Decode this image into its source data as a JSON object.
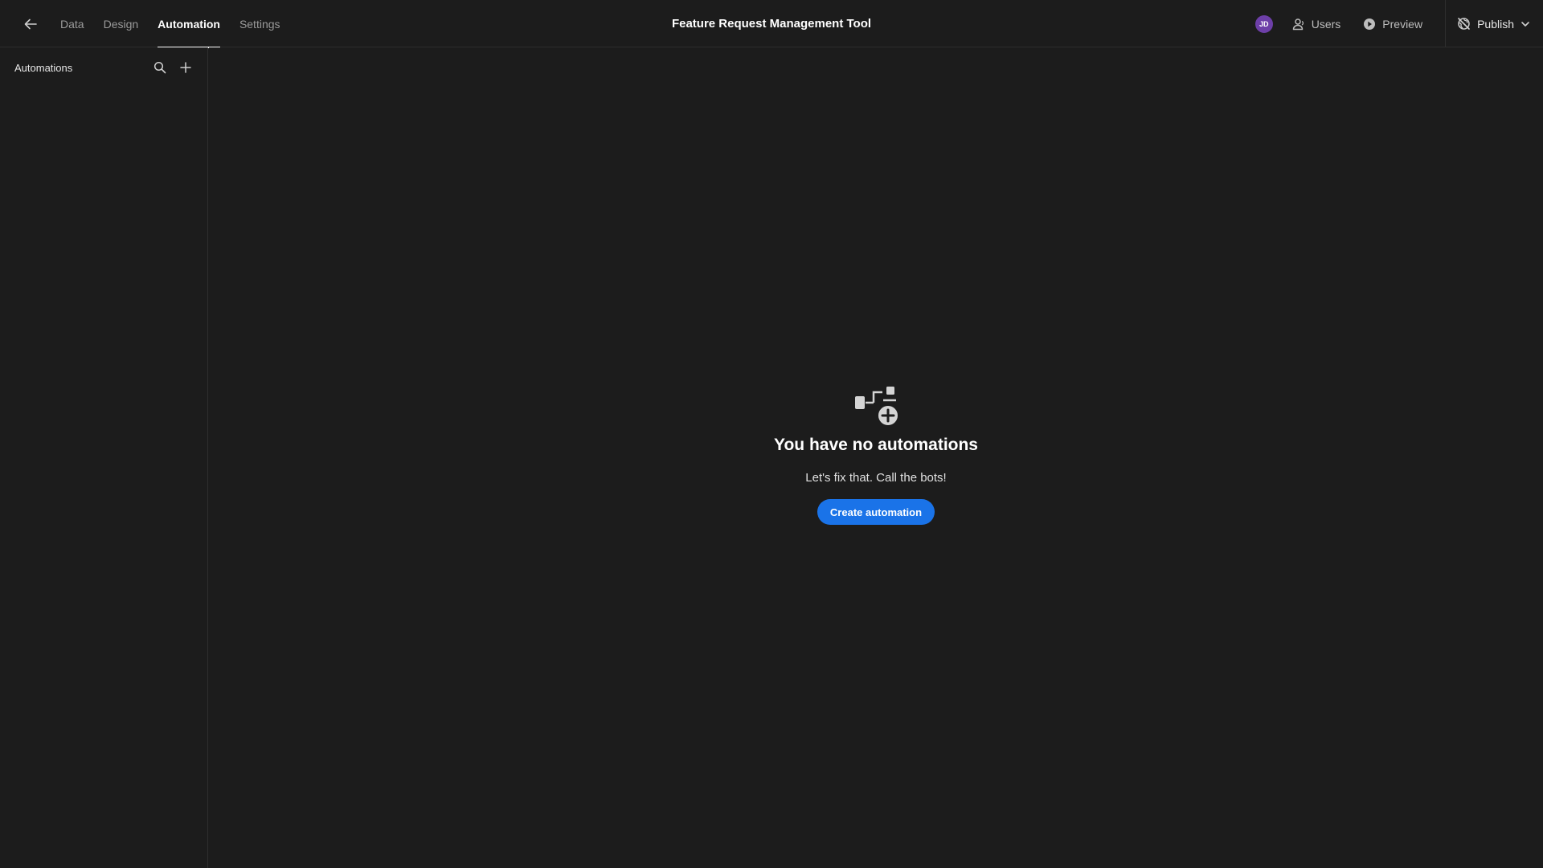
{
  "header": {
    "title": "Feature Request Management Tool",
    "tabs": [
      {
        "label": "Data",
        "active": false
      },
      {
        "label": "Design",
        "active": false
      },
      {
        "label": "Automation",
        "active": true
      },
      {
        "label": "Settings",
        "active": false
      }
    ],
    "avatar_initials": "JD",
    "users_label": "Users",
    "preview_label": "Preview",
    "publish_label": "Publish"
  },
  "sidebar": {
    "title": "Automations"
  },
  "empty_state": {
    "title": "You have no automations",
    "subtitle": "Let's fix that. Call the bots!",
    "button_label": "Create automation"
  },
  "icons": {
    "back": "arrow-left-icon",
    "users": "user-icon",
    "preview": "play-circle-icon",
    "publish": "globe-off-icon",
    "publish_menu": "chevron-down-icon",
    "search": "search-icon",
    "add": "plus-icon",
    "empty": "automation-add-icon"
  },
  "colors": {
    "background": "#1c1c1c",
    "accent": "#1a73e8",
    "avatar": "#6d3fa8"
  }
}
